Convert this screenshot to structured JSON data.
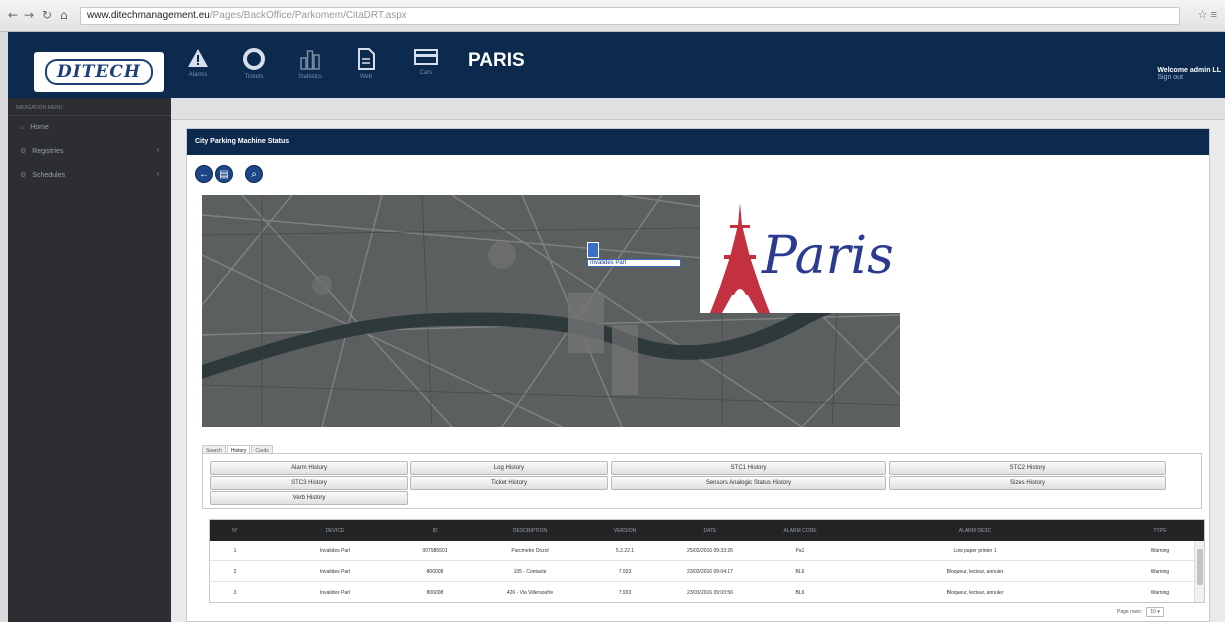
{
  "browser": {
    "url_host": "www.ditechmanagement.eu",
    "url_path": "/Pages/BackOffice/Parkomem/CitaDRT.aspx"
  },
  "header": {
    "logo_text": "DITECH",
    "city": "PARIS",
    "welcome": "Welcome admin LL",
    "sign_out": "Sign out",
    "nav": [
      {
        "label": "Alarms",
        "icon": "warning-icon"
      },
      {
        "label": "Tickets",
        "icon": "lifebuoy-icon"
      },
      {
        "label": "Statistics",
        "icon": "bar-chart-icon"
      },
      {
        "label": "Web",
        "icon": "document-icon"
      },
      {
        "label": "Cars",
        "icon": "card-icon"
      }
    ]
  },
  "sidebar": {
    "section": "NAVIGATION MENU",
    "items": [
      {
        "label": "Home",
        "icon": "home-icon"
      },
      {
        "label": "Registries",
        "icon": "gear-icon"
      },
      {
        "label": "Schedules",
        "icon": "gear-icon"
      }
    ]
  },
  "panel": {
    "title": "City Parking Machine Status"
  },
  "map": {
    "marker_label": "Invalides Parl",
    "logo_text": "Paris"
  },
  "tabs": [
    "Search",
    "History",
    "Cards"
  ],
  "history_buttons": [
    [
      "Alarm History",
      "Log History",
      "STC1 History",
      "STC2 History"
    ],
    [
      "STC3 History",
      "Ticket History",
      "Sensors Analogic Status History",
      "Sizes History"
    ],
    [
      "Verb History"
    ]
  ],
  "grid": {
    "columns": [
      "N°",
      "DEVICE",
      "ID",
      "DESCRIPTION",
      "VERSION",
      "DATE",
      "ALARM CODE",
      "ALARM DESC",
      "TYPE"
    ],
    "rows": [
      [
        "1",
        "Invalides Parl",
        "007985501",
        "Parcmetre Dozol",
        "5.2.22.1",
        "25/03/2016 09:33:26",
        "Pa1",
        "Low paper printer 1",
        "Warning"
      ],
      [
        "2",
        "Invalides Parl",
        "806008",
        "105 - Contacte",
        "7.933",
        "23/03/2016 09:04:17",
        "BL6",
        "Bloqueur, lecteur, annuler",
        "Warning"
      ],
      [
        "3",
        "Invalides Parl",
        "806008",
        "426 - Via Villersoufre",
        "7.933",
        "23/03/2016 09:03:56",
        "BL6",
        "Bloqueur, lecteur, annuler",
        "Warning"
      ]
    ]
  },
  "pager": {
    "label": "Page rows:",
    "value": "10"
  },
  "colors": {
    "header_bg": "#0b2a4e",
    "sidebar_bg": "#2c2e32",
    "grid_head_bg": "#222426"
  }
}
